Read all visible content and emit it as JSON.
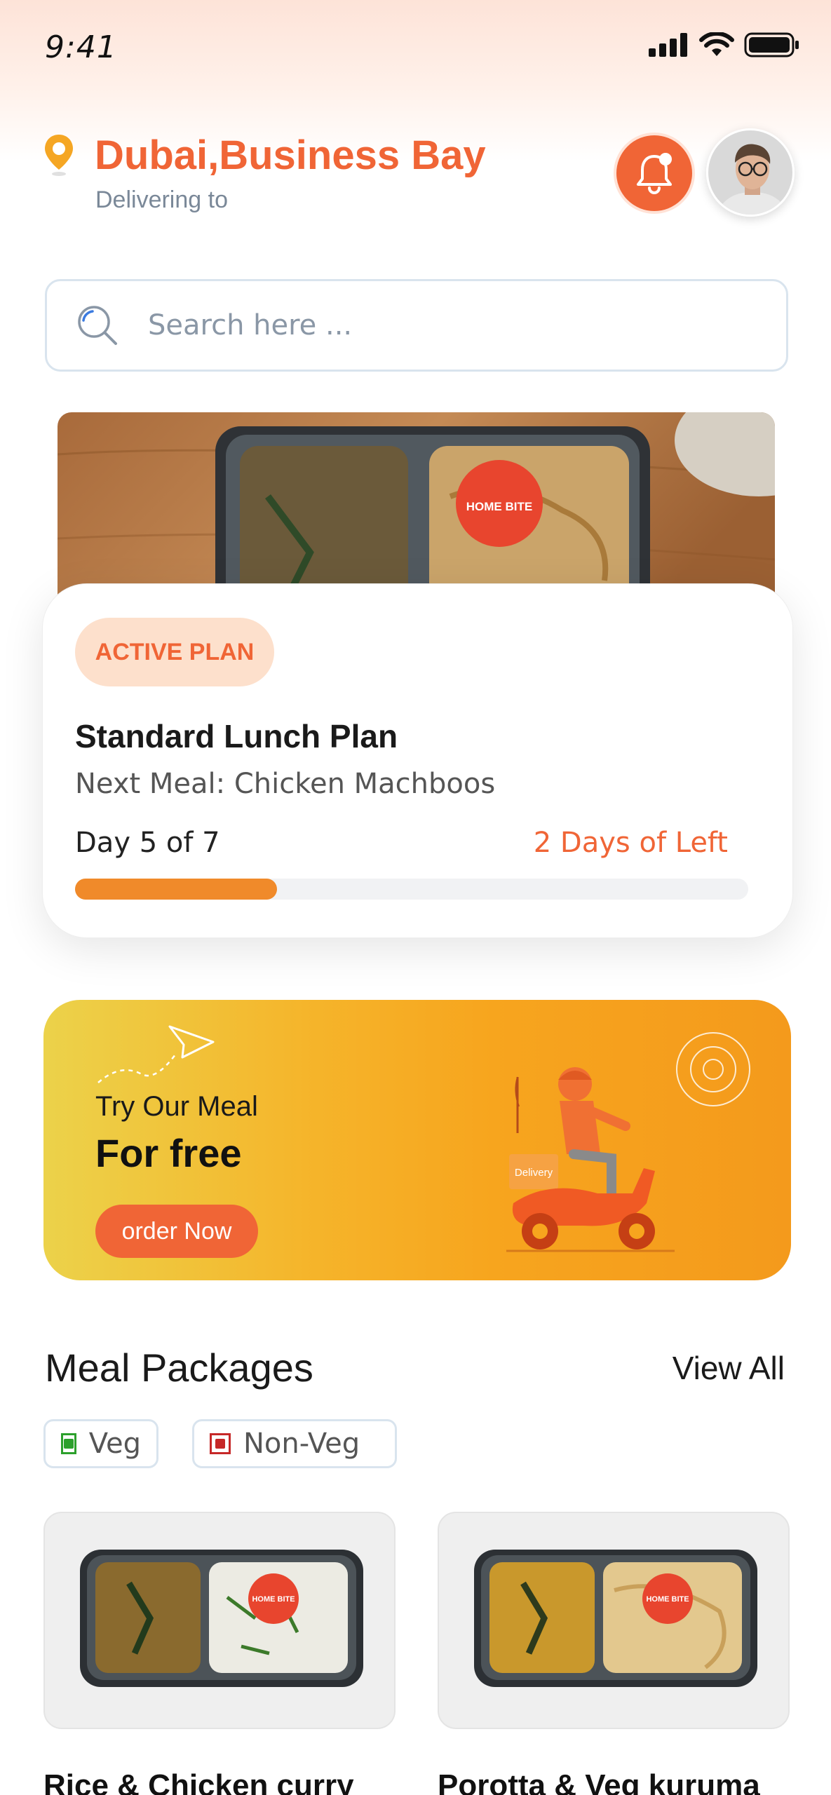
{
  "status_bar": {
    "time": "9:41"
  },
  "header": {
    "location": "Dubai,Business Bay",
    "delivering_label": "Delivering to"
  },
  "search": {
    "placeholder": "Search here ..."
  },
  "active_plan": {
    "badge": "ACTIVE PLAN",
    "title": "Standard Lunch Plan",
    "next_meal": "Next Meal: Chicken Machboos",
    "day_progress": "Day 5 of 7",
    "days_left": "2 Days of Left",
    "progress_fraction": 0.3,
    "hero_sticker_text": "HOME BITE"
  },
  "promo": {
    "line1": "Try Our Meal",
    "line2": "For free",
    "button": "order Now",
    "box_label": "Delivery"
  },
  "meal_packages": {
    "title": "Meal Packages",
    "view_all": "View All",
    "filters": [
      {
        "label": "Veg",
        "color": "#2ca02c"
      },
      {
        "label": "Non-Veg",
        "color": "#c62828"
      }
    ],
    "items": [
      {
        "title": "Rice & Chicken curry",
        "sticker": "HOME BITE"
      },
      {
        "title": "Porotta & Veg kuruma",
        "sticker": "HOME BITE"
      }
    ]
  },
  "colors": {
    "accent": "#f06536",
    "progress": "#f08a2a",
    "promo_gradient_start": "#ecd24a",
    "promo_gradient_end": "#f49a1c"
  }
}
